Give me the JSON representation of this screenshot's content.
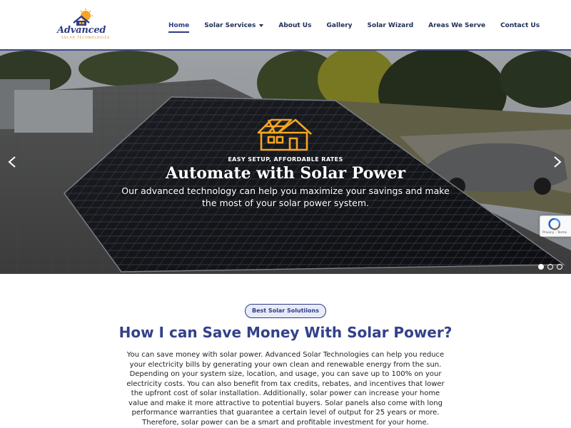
{
  "brand": {
    "name": "Advanced",
    "tagline": "SOLAR TECHNOLOGIES",
    "primary_color": "#2e3c86",
    "accent_color": "#f5a623"
  },
  "nav": {
    "items": [
      {
        "label": "Home",
        "active": true,
        "has_dropdown": false
      },
      {
        "label": "Solar Services",
        "active": false,
        "has_dropdown": true
      },
      {
        "label": "About Us",
        "active": false,
        "has_dropdown": false
      },
      {
        "label": "Gallery",
        "active": false,
        "has_dropdown": false
      },
      {
        "label": "Solar Wizard",
        "active": false,
        "has_dropdown": false
      },
      {
        "label": "Areas We Serve",
        "active": false,
        "has_dropdown": false
      },
      {
        "label": "Contact Us",
        "active": false,
        "has_dropdown": false
      }
    ]
  },
  "hero": {
    "icon": "solar-house-icon",
    "eyebrow": "EASY SETUP, AFFORDABLE RATES",
    "title": "Automate with Solar Power",
    "subtitle": "Our advanced technology can help you maximize your savings and make the most of your solar power system.",
    "prev_icon": "chevron-left-icon",
    "next_icon": "chevron-right-icon",
    "slide_count": 3,
    "active_slide": 1
  },
  "recaptcha": {
    "text": "Privacy - Terms"
  },
  "section": {
    "badge": "Best Solar Solutiions",
    "title": "How I can Save Money With Solar Power?",
    "body": "You can save money with solar power. Advanced Solar Technologies can help you reduce your electricity bills by generating your own clean and renewable energy from the sun. Depending on your system size, location, and usage, you can save up to 100% on your electricity costs. You can also benefit from tax credits, rebates, and incentives that lower the upfront cost of solar installation. Additionally, solar power can increase your home value and make it more attractive to potential buyers. Solar panels also come with long performance warranties that guarantee a certain level of output for 25 years or more. Therefore, solar power can be a smart and profitable investment for your home."
  }
}
